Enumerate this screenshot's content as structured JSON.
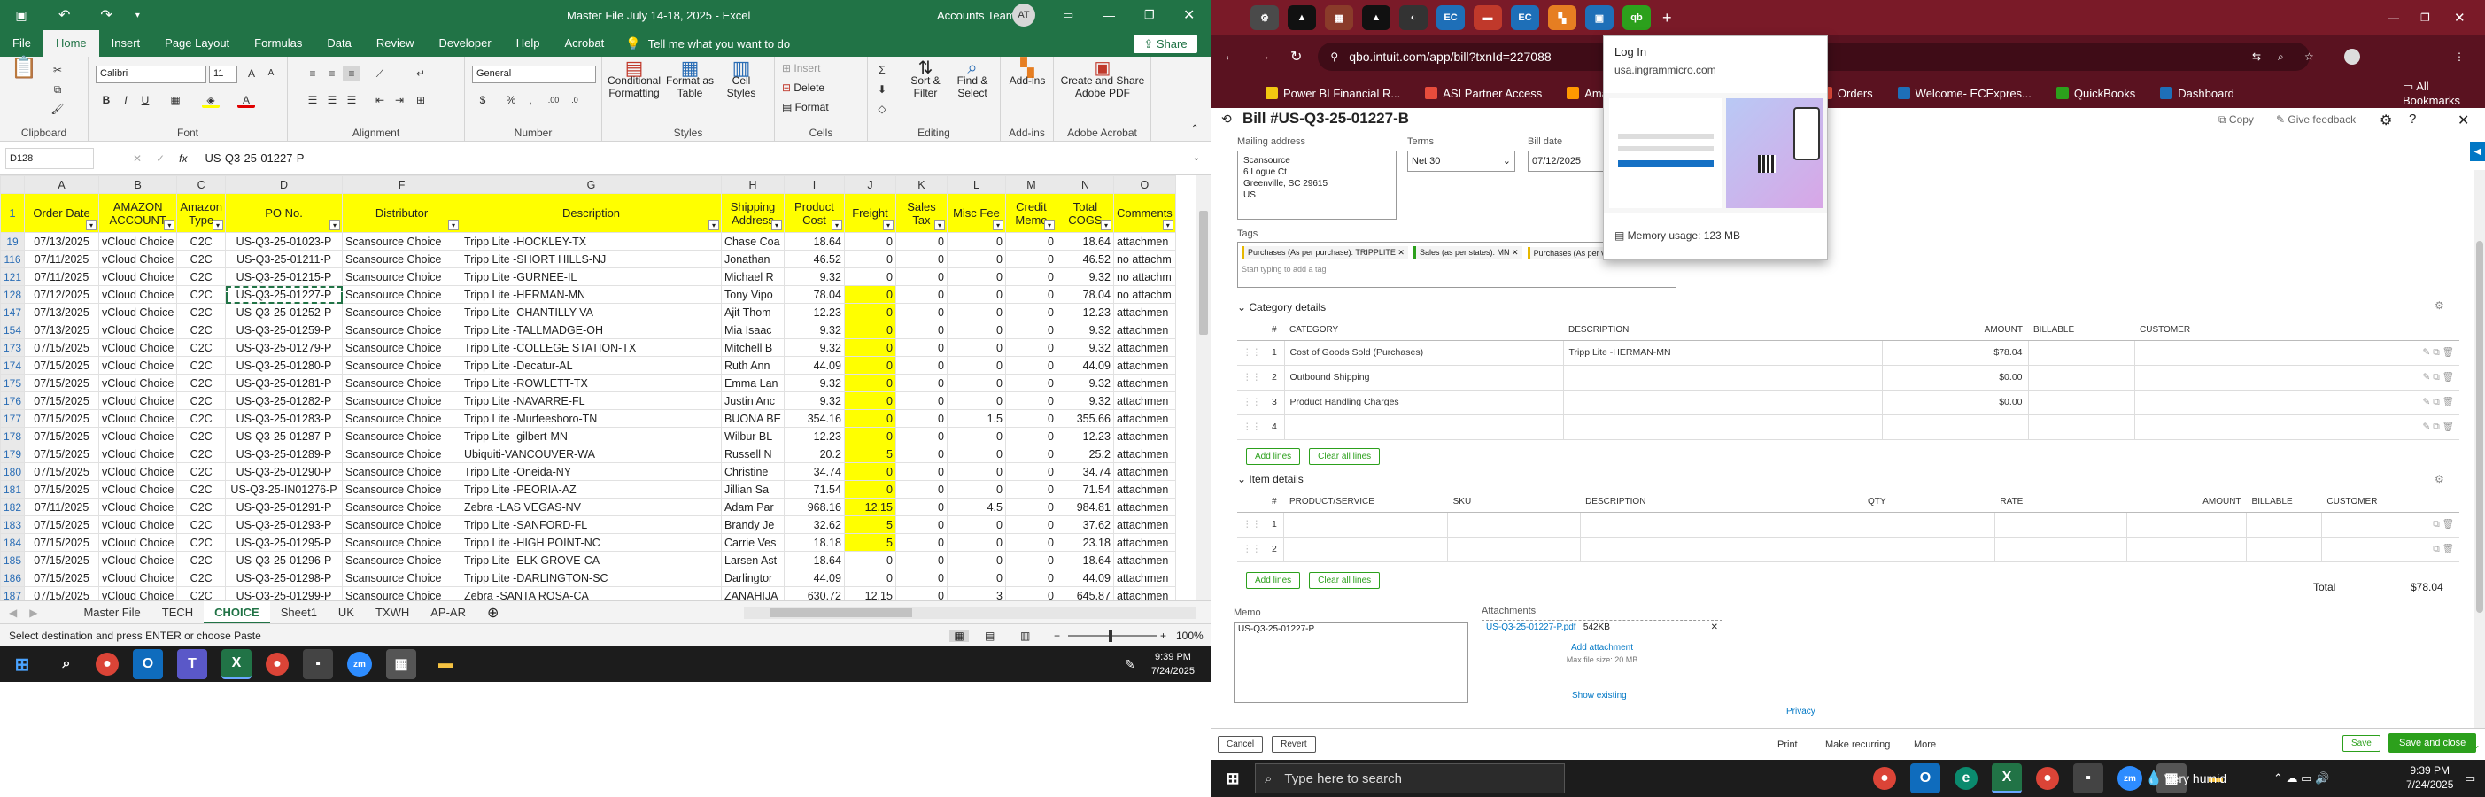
{
  "excel": {
    "title": "Master File July 14-18, 2025 - Excel",
    "account": "Accounts Team",
    "avatar": "AT",
    "tabs": [
      "File",
      "Home",
      "Insert",
      "Page Layout",
      "Formulas",
      "Data",
      "Review",
      "Developer",
      "Help",
      "Acrobat"
    ],
    "tell_me": "Tell me what you want to do",
    "share": "Share",
    "ribbon": {
      "clipboard": "Clipboard",
      "font": "Font",
      "alignment": "Alignment",
      "number": "Number",
      "styles": "Styles",
      "cells": "Cells",
      "editing": "Editing",
      "addins": "Add-ins",
      "adobe": "Adobe Acrobat",
      "font_name": "Calibri",
      "font_size": "11",
      "number_format": "General",
      "conditional": "Conditional Formatting",
      "format_table": "Format as Table",
      "cell_styles": "Cell Styles",
      "insert": "Insert",
      "delete": "Delete",
      "format": "Format",
      "sort": "Sort & Filter",
      "find": "Find & Select",
      "addins_btn": "Add-ins",
      "create_pdf": "Create and Share Adobe PDF"
    },
    "name_box": "D128",
    "formula": "US-Q3-25-01227-P",
    "columns": [
      "A",
      "B",
      "C",
      "D",
      "F",
      "G",
      "H",
      "I",
      "J",
      "K",
      "L",
      "M",
      "N",
      "O"
    ],
    "headers": [
      "Order Date",
      "AMAZON ACCOUNT",
      "Amazon Type",
      "PO No.",
      "Distributor",
      "Description",
      "Shipping Address",
      "Product Cost",
      "Freight",
      "Sales Tax",
      "Misc Fee",
      "Credit Memo",
      "Total COGS",
      "Comments"
    ],
    "rows": [
      {
        "n": "19",
        "c": [
          "07/13/2025",
          "vCloud Choice",
          "C2C",
          "US-Q3-25-01023-P",
          "Scansource Choice",
          "Tripp Lite -HOCKLEY-TX",
          "Chase Coa",
          "18.64",
          "0",
          "0",
          "0",
          "0",
          "18.64",
          "attachmen"
        ]
      },
      {
        "n": "116",
        "c": [
          "07/11/2025",
          "vCloud Choice",
          "C2C",
          "US-Q3-25-01211-P",
          "Scansource Choice",
          "Tripp Lite -SHORT HILLS-NJ",
          "Jonathan",
          "46.52",
          "0",
          "0",
          "0",
          "0",
          "46.52",
          "no attachm"
        ]
      },
      {
        "n": "121",
        "c": [
          "07/11/2025",
          "vCloud Choice",
          "C2C",
          "US-Q3-25-01215-P",
          "Scansource Choice",
          "Tripp Lite -GURNEE-IL",
          "Michael R",
          "9.32",
          "0",
          "0",
          "0",
          "0",
          "9.32",
          "no attachm"
        ]
      },
      {
        "n": "128",
        "c": [
          "07/12/2025",
          "vCloud Choice",
          "C2C",
          "US-Q3-25-01227-P",
          "Scansource Choice",
          "Tripp Lite -HERMAN-MN",
          "Tony Vipo",
          "78.04",
          "0",
          "0",
          "0",
          "0",
          "78.04",
          "no attachm"
        ]
      },
      {
        "n": "147",
        "c": [
          "07/13/2025",
          "vCloud Choice",
          "C2C",
          "US-Q3-25-01252-P",
          "Scansource Choice",
          "Tripp Lite -CHANTILLY-VA",
          "Ajit Thom",
          "12.23",
          "0",
          "0",
          "0",
          "0",
          "12.23",
          "attachmen"
        ]
      },
      {
        "n": "154",
        "c": [
          "07/13/2025",
          "vCloud Choice",
          "C2C",
          "US-Q3-25-01259-P",
          "Scansource Choice",
          "Tripp Lite -TALLMADGE-OH",
          "Mia Isaac",
          "9.32",
          "0",
          "0",
          "0",
          "0",
          "9.32",
          "attachmen"
        ]
      },
      {
        "n": "173",
        "c": [
          "07/15/2025",
          "vCloud Choice",
          "C2C",
          "US-Q3-25-01279-P",
          "Scansource Choice",
          "Tripp Lite -COLLEGE STATION-TX",
          "Mitchell B",
          "9.32",
          "0",
          "0",
          "0",
          "0",
          "9.32",
          "attachmen"
        ]
      },
      {
        "n": "174",
        "c": [
          "07/15/2025",
          "vCloud Choice",
          "C2C",
          "US-Q3-25-01280-P",
          "Scansource Choice",
          "Tripp Lite -Decatur-AL",
          "Ruth Ann",
          "44.09",
          "0",
          "0",
          "0",
          "0",
          "44.09",
          "attachmen"
        ]
      },
      {
        "n": "175",
        "c": [
          "07/15/2025",
          "vCloud Choice",
          "C2C",
          "US-Q3-25-01281-P",
          "Scansource Choice",
          "Tripp Lite -ROWLETT-TX",
          "Emma Lan",
          "9.32",
          "0",
          "0",
          "0",
          "0",
          "9.32",
          "attachmen"
        ]
      },
      {
        "n": "176",
        "c": [
          "07/15/2025",
          "vCloud Choice",
          "C2C",
          "US-Q3-25-01282-P",
          "Scansource Choice",
          "Tripp Lite -NAVARRE-FL",
          "Justin Anc",
          "9.32",
          "0",
          "0",
          "0",
          "0",
          "9.32",
          "attachmen"
        ]
      },
      {
        "n": "177",
        "c": [
          "07/15/2025",
          "vCloud Choice",
          "C2C",
          "US-Q3-25-01283-P",
          "Scansource Choice",
          "Tripp Lite -Murfeesboro-TN",
          "BUONA BE",
          "354.16",
          "0",
          "0",
          "1.5",
          "0",
          "355.66",
          "attachmen"
        ]
      },
      {
        "n": "178",
        "c": [
          "07/15/2025",
          "vCloud Choice",
          "C2C",
          "US-Q3-25-01287-P",
          "Scansource Choice",
          "Tripp Lite -gilbert-MN",
          "Wilbur BL",
          "12.23",
          "0",
          "0",
          "0",
          "0",
          "12.23",
          "attachmen"
        ]
      },
      {
        "n": "179",
        "c": [
          "07/15/2025",
          "vCloud Choice",
          "C2C",
          "US-Q3-25-01289-P",
          "Scansource Choice",
          "Ubiquiti-VANCOUVER-WA",
          "Russell N",
          "20.2",
          "5",
          "0",
          "0",
          "0",
          "25.2",
          "attachmen"
        ]
      },
      {
        "n": "180",
        "c": [
          "07/15/2025",
          "vCloud Choice",
          "C2C",
          "US-Q3-25-01290-P",
          "Scansource Choice",
          "Tripp Lite -Oneida-NY",
          "Christine",
          "34.74",
          "0",
          "0",
          "0",
          "0",
          "34.74",
          "attachmen"
        ]
      },
      {
        "n": "181",
        "c": [
          "07/15/2025",
          "vCloud Choice",
          "C2C",
          "US-Q3-25-IN01276-P",
          "Scansource Choice",
          "Tripp Lite -PEORIA-AZ",
          "Jillian Sa",
          "71.54",
          "0",
          "0",
          "0",
          "0",
          "71.54",
          "attachmen"
        ]
      },
      {
        "n": "182",
        "c": [
          "07/11/2025",
          "vCloud Choice",
          "C2C",
          "US-Q3-25-01291-P",
          "Scansource Choice",
          "Zebra -LAS VEGAS-NV",
          "Adam Par",
          "968.16",
          "12.15",
          "0",
          "4.5",
          "0",
          "984.81",
          "attachmen"
        ]
      },
      {
        "n": "183",
        "c": [
          "07/15/2025",
          "vCloud Choice",
          "C2C",
          "US-Q3-25-01293-P",
          "Scansource Choice",
          "Tripp Lite -SANFORD-FL",
          "Brandy Je",
          "32.62",
          "5",
          "0",
          "0",
          "0",
          "37.62",
          "attachmen"
        ]
      },
      {
        "n": "184",
        "c": [
          "07/15/2025",
          "vCloud Choice",
          "C2C",
          "US-Q3-25-01295-P",
          "Scansource Choice",
          "Tripp Lite -HIGH POINT-NC",
          "Carrie Ves",
          "18.18",
          "5",
          "0",
          "0",
          "0",
          "23.18",
          "attachmen"
        ]
      },
      {
        "n": "185",
        "c": [
          "07/15/2025",
          "vCloud Choice",
          "C2C",
          "US-Q3-25-01296-P",
          "Scansource Choice",
          "Tripp Lite -ELK GROVE-CA",
          "Larsen Ast",
          "18.64",
          "0",
          "0",
          "0",
          "0",
          "18.64",
          "attachmen"
        ]
      },
      {
        "n": "186",
        "c": [
          "07/15/2025",
          "vCloud Choice",
          "C2C",
          "US-Q3-25-01298-P",
          "Scansource Choice",
          "Tripp Lite -DARLINGTON-SC",
          "Darlingtor",
          "44.09",
          "0",
          "0",
          "0",
          "0",
          "44.09",
          "attachmen"
        ]
      },
      {
        "n": "187",
        "c": [
          "07/15/2025",
          "vCloud Choice",
          "C2C",
          "US-Q3-25-01299-P",
          "Scansource Choice",
          "Zebra -SANTA ROSA-CA",
          "ZANAHIJA",
          "630.72",
          "12.15",
          "0",
          "3",
          "0",
          "645.87",
          "attachmen"
        ]
      }
    ],
    "sheets": [
      "Master File",
      "TECH",
      "CHOICE",
      "Sheet1",
      "UK",
      "TXWH",
      "AP-AR"
    ],
    "status": "Select destination and press ENTER or choose Paste",
    "zoom": "100%"
  },
  "taskbar1": {
    "time": "9:39 PM",
    "date": "7/24/2025"
  },
  "chrome": {
    "url": "qbo.intuit.com/app/bill?txnId=227088",
    "bookmarks": [
      "Power BI Financial R...",
      "ASI Partner Access",
      "Amazon",
      "Orders",
      "Welcome- ECExpres...",
      "QuickBooks",
      "Dashboard"
    ],
    "all_bookmarks": "All Bookmarks",
    "popup": {
      "title": "Log In",
      "url": "usa.ingrammicro.com",
      "memory": "Memory usage: 123 MB"
    },
    "bill": {
      "title": "Bill #US-Q3-25-01227-B",
      "copy": "Copy",
      "feedback": "Give feedback",
      "mailing_label": "Mailing address",
      "mailing": [
        "Scansource",
        "6 Logue Ct",
        "Greenville, SC 29615",
        "US"
      ],
      "terms_label": "Terms",
      "terms": "Net 30",
      "bill_date_label": "Bill date",
      "bill_date": "07/12/2025",
      "tags_label": "Tags",
      "tags": [
        "Purchases (As per purchase): TRIPPLITE",
        "Sales (as per states): MN",
        "Purchases (As per vendo"
      ],
      "tags_placeholder": "Start typing to add a tag",
      "category_title": "Category details",
      "cat_headers": [
        "#",
        "CATEGORY",
        "DESCRIPTION",
        "AMOUNT",
        "BILLABLE",
        "CUSTOMER"
      ],
      "cat_rows": [
        {
          "n": "1",
          "cat": "Cost of Goods Sold (Purchases)",
          "desc": "Tripp Lite -HERMAN-MN",
          "amt": "$78.04"
        },
        {
          "n": "2",
          "cat": "Outbound Shipping",
          "desc": "",
          "amt": "$0.00"
        },
        {
          "n": "3",
          "cat": "Product Handling Charges",
          "desc": "",
          "amt": "$0.00"
        },
        {
          "n": "4",
          "cat": "",
          "desc": "",
          "amt": ""
        }
      ],
      "add_lines": "Add lines",
      "clear_lines": "Clear all lines",
      "item_title": "Item details",
      "item_headers": [
        "#",
        "PRODUCT/SERVICE",
        "SKU",
        "DESCRIPTION",
        "QTY",
        "RATE",
        "AMOUNT",
        "BILLABLE",
        "CUSTOMER"
      ],
      "item_rows": [
        "1",
        "2"
      ],
      "total_label": "Total",
      "total": "$78.04",
      "memo_label": "Memo",
      "memo": "US-Q3-25-01227-P",
      "attach_label": "Attachments",
      "attach_file": "US-Q3-25-01227-P.pdf",
      "attach_size": "542KB",
      "add_attach": "Add attachment",
      "max_size": "Max file size: 20 MB",
      "show_existing": "Show existing",
      "privacy": "Privacy"
    },
    "footer": {
      "cancel": "Cancel",
      "revert": "Revert",
      "print": "Print",
      "recurring": "Make recurring",
      "more": "More",
      "save": "Save",
      "save_close": "Save and close"
    }
  },
  "taskbar2": {
    "search": "Type here to search",
    "weather": "Very humid",
    "time": "9:39 PM",
    "date": "7/24/2025"
  },
  "colors": {
    "excel_green": "#217346",
    "chrome_tab": "#7a1a28",
    "qb_green": "#2ca01c",
    "highlight": "#ffff00"
  }
}
